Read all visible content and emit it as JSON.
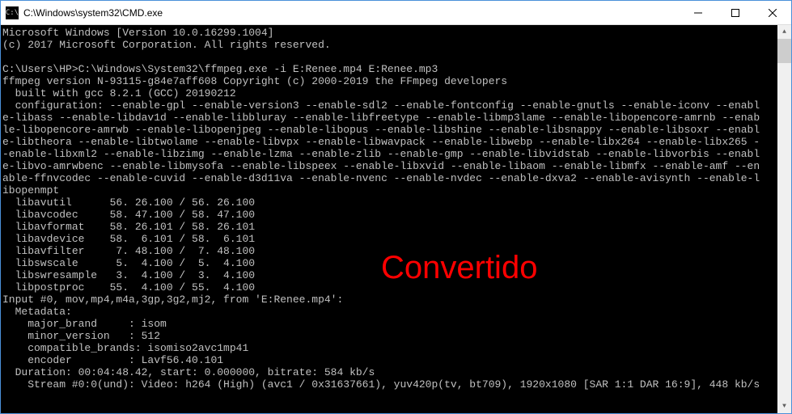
{
  "window": {
    "title": "C:\\Windows\\system32\\CMD.exe",
    "icon_label": "C:\\"
  },
  "terminal": {
    "lines": [
      "Microsoft Windows [Version 10.0.16299.1004]",
      "(c) 2017 Microsoft Corporation. All rights reserved.",
      "",
      "C:\\Users\\HP>C:\\Windows\\System32\\ffmpeg.exe -i E:Renee.mp4 E:Renee.mp3",
      "ffmpeg version N-93115-g84e7aff608 Copyright (c) 2000-2019 the FFmpeg developers",
      "  built with gcc 8.2.1 (GCC) 20190212",
      "  configuration: --enable-gpl --enable-version3 --enable-sdl2 --enable-fontconfig --enable-gnutls --enable-iconv --enabl",
      "e-libass --enable-libdav1d --enable-libbluray --enable-libfreetype --enable-libmp3lame --enable-libopencore-amrnb --enab",
      "le-libopencore-amrwb --enable-libopenjpeg --enable-libopus --enable-libshine --enable-libsnappy --enable-libsoxr --enabl",
      "e-libtheora --enable-libtwolame --enable-libvpx --enable-libwavpack --enable-libwebp --enable-libx264 --enable-libx265 -",
      "-enable-libxml2 --enable-libzimg --enable-lzma --enable-zlib --enable-gmp --enable-libvidstab --enable-libvorbis --enabl",
      "e-libvo-amrwbenc --enable-libmysofa --enable-libspeex --enable-libxvid --enable-libaom --enable-libmfx --enable-amf --en",
      "able-ffnvcodec --enable-cuvid --enable-d3d11va --enable-nvenc --enable-nvdec --enable-dxva2 --enable-avisynth --enable-l",
      "ibopenmpt",
      "  libavutil      56. 26.100 / 56. 26.100",
      "  libavcodec     58. 47.100 / 58. 47.100",
      "  libavformat    58. 26.101 / 58. 26.101",
      "  libavdevice    58.  6.101 / 58.  6.101",
      "  libavfilter     7. 48.100 /  7. 48.100",
      "  libswscale      5.  4.100 /  5.  4.100",
      "  libswresample   3.  4.100 /  3.  4.100",
      "  libpostproc    55.  4.100 / 55.  4.100",
      "Input #0, mov,mp4,m4a,3gp,3g2,mj2, from 'E:Renee.mp4':",
      "  Metadata:",
      "    major_brand     : isom",
      "    minor_version   : 512",
      "    compatible_brands: isomiso2avc1mp41",
      "    encoder         : Lavf56.40.101",
      "  Duration: 00:04:48.42, start: 0.000000, bitrate: 584 kb/s",
      "    Stream #0:0(und): Video: h264 (High) (avc1 / 0x31637661), yuv420p(tv, bt709), 1920x1080 [SAR 1:1 DAR 16:9], 448 kb/s"
    ]
  },
  "overlay": {
    "text": "Convertido"
  }
}
